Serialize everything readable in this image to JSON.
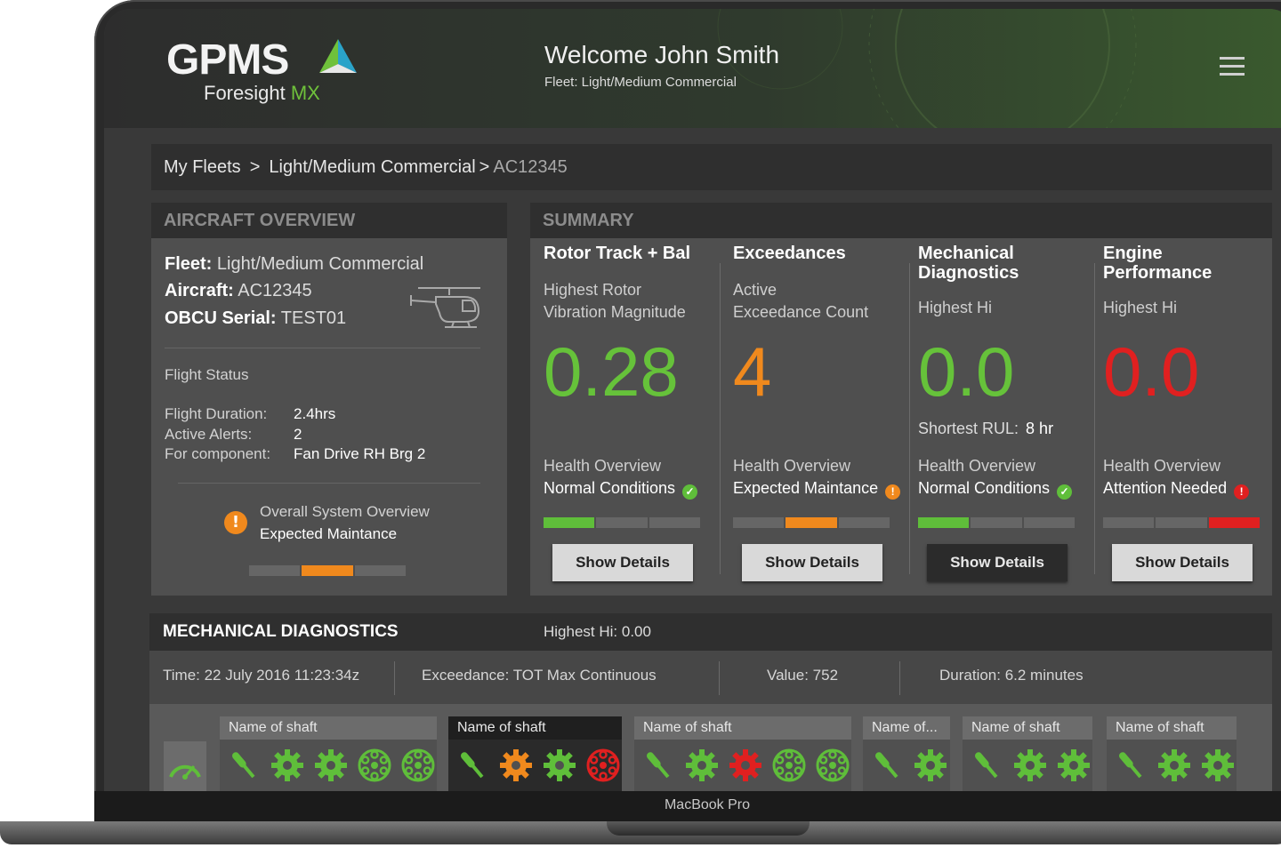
{
  "header": {
    "logo_text": "GPMS",
    "logo_sub": "Foresight",
    "logo_sub_accent": "MX",
    "welcome": "Welcome John Smith",
    "fleet_line": "Fleet: Light/Medium Commercial"
  },
  "breadcrumb": {
    "items": [
      "My Fleets",
      "Light/Medium Commercial"
    ],
    "separators": [
      ">",
      ">"
    ],
    "current": "AC12345"
  },
  "overview": {
    "title": "AIRCRAFT OVERVIEW",
    "fleet_label": "Fleet:",
    "fleet_value": "Light/Medium Commercial",
    "aircraft_label": "Aircraft:",
    "aircraft_value": "AC12345",
    "obcu_label": "OBCU Serial:",
    "obcu_value": "TEST01",
    "flight_status": "Flight Status",
    "duration_label": "Flight Duration:",
    "duration_value": "2.4hrs",
    "alerts_label": "Active Alerts:",
    "alerts_value": "2",
    "component_label": "For component:",
    "component_value": "Fan Drive RH Brg 2",
    "system_overview_label": "Overall System Overview",
    "system_overview_status": "Expected Maintance",
    "health_level": 2
  },
  "summary": {
    "title": "SUMMARY",
    "columns": [
      {
        "title": "Rotor Track + Bal",
        "subtitle": "Highest Rotor\nVibration Magnitude",
        "value": "0.28",
        "value_color": "#66c23a",
        "rul_label": "",
        "rul_value": "",
        "health_label": "Health Overview",
        "health_status": "Normal Conditions",
        "status": "ok",
        "health_level": 1,
        "button": "Show Details"
      },
      {
        "title": "Exceedances",
        "subtitle": "Active\nExceedance Count",
        "value": "4",
        "value_color": "#f0891d",
        "rul_label": "",
        "rul_value": "",
        "health_label": "Health Overview",
        "health_status": "Expected Maintance",
        "status": "warn",
        "health_level": 2,
        "button": "Show Details"
      },
      {
        "title": "Mechanical\nDiagnostics",
        "subtitle": "Highest Hi",
        "value": "0.0",
        "value_color": "#66c23a",
        "rul_label": "Shortest RUL:",
        "rul_value": "8 hr",
        "health_label": "Health Overview",
        "health_status": "Normal Conditions",
        "status": "ok",
        "health_level": 1,
        "button": "Show Details"
      },
      {
        "title": "Engine\nPerformance",
        "subtitle": "Highest Hi",
        "value": "0.0",
        "value_color": "#e02020",
        "rul_label": "",
        "rul_value": "",
        "health_label": "Health Overview",
        "health_status": "Attention Needed",
        "status": "alert",
        "health_level": 3,
        "button": "Show Details"
      }
    ]
  },
  "mechanical": {
    "title": "MECHANICAL DIAGNOSTICS",
    "highest_hi": "Highest Hi:  0.00",
    "time": "Time: 22 July 2016 11:23:34z",
    "exceedance": "Exceedance: TOT Max Continuous",
    "value": "Value: 752",
    "duration": "Duration: 6.2 minutes",
    "shafts": [
      {
        "label": "Name of shaft",
        "active": false,
        "icons": [
          "green",
          "green",
          "green",
          "green",
          "green"
        ]
      },
      {
        "label": "Name of shaft",
        "active": true,
        "icons": [
          "green",
          "orange",
          "green",
          "red"
        ]
      },
      {
        "label": "Name of shaft",
        "active": false,
        "icons": [
          "green",
          "green",
          "red",
          "green",
          "green"
        ]
      },
      {
        "label": "Name of...",
        "active": false,
        "icons": [
          "green",
          "green"
        ]
      },
      {
        "label": "Name of shaft",
        "active": false,
        "icons": [
          "green",
          "green",
          "green"
        ]
      },
      {
        "label": "Name of shaft",
        "active": false,
        "icons": [
          "green",
          "green",
          "green"
        ]
      }
    ]
  },
  "colors": {
    "green": "#5fbe3a",
    "orange": "#f0891d",
    "red": "#e02020",
    "bar_empty": "#666666"
  },
  "device_label": "MacBook Pro"
}
